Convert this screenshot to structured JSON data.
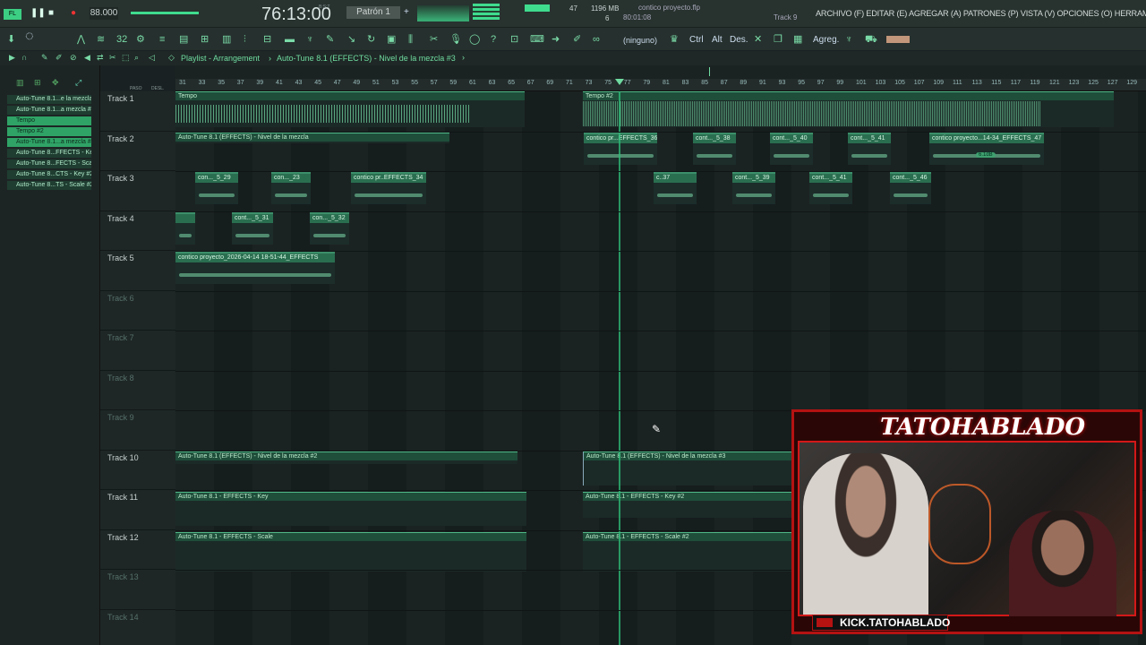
{
  "top": {
    "tempo": "88.000",
    "time": "76:13:00",
    "time_sub": "B:S:T",
    "pattern": "Patrón 1",
    "cpu": "47",
    "mem": "1196 MB",
    "voices": "6",
    "hint_file": "contico proyecto.flp",
    "hint_time": "80:01:08",
    "hint_track": "Track 9",
    "menu": "ARCHIVO (F) EDITAR (E) AGREGAR (A) PATRONES (P) VISTA (V) OPCIONES (O) HERRAMIENTAS (T) AYUDA"
  },
  "toolbar": {
    "ninguno": "(ninguno)",
    "ctrl": "Ctrl",
    "alt": "Alt",
    "des": "Des.",
    "agreg": "Agreg."
  },
  "playlist": {
    "title": "Playlist - Arrangement",
    "subtitle": "Auto-Tune 8.1 (EFFECTS) - Nivel de la mezcla #3",
    "paso": "PASO",
    "desl": "DESL."
  },
  "left_panel": {
    "items": [
      "Auto-Tune 8.1...e la mezcla",
      "Auto-Tune 8.1...a mezcla #2",
      "Tempo",
      "Tempo #2",
      "Auto-Tune 8.1...a mezcla #3",
      "Auto-Tune 8...FFECTS - Key",
      "Auto-Tune 8...FECTS - Scale",
      "Auto-Tune 8...CTS - Key #2",
      "Auto-Tune 8...TS - Scale #2"
    ]
  },
  "ruler": [
    "31",
    "33",
    "35",
    "37",
    "39",
    "41",
    "43",
    "45",
    "47",
    "49",
    "51",
    "53",
    "55",
    "57",
    "59",
    "61",
    "63",
    "65",
    "67",
    "69",
    "71",
    "73",
    "75",
    "77",
    "79",
    "81",
    "83",
    "85",
    "87",
    "89",
    "91",
    "93",
    "95",
    "97",
    "99",
    "101",
    "103",
    "105",
    "107",
    "109",
    "111",
    "113",
    "115",
    "117",
    "119",
    "121",
    "123",
    "125",
    "127",
    "129"
  ],
  "tracks": [
    "Track 1",
    "Track 2",
    "Track 3",
    "Track 4",
    "Track 5",
    "Track 6",
    "Track 7",
    "Track 8",
    "Track 9",
    "Track 10",
    "Track 11",
    "Track 12",
    "Track 13",
    "Track 14"
  ],
  "clips": {
    "t1a": "Tempo",
    "t1b": "Tempo #2",
    "t2a": "Auto-Tune 8.1 (EFFECTS) - Nivel de la mezcla",
    "t2b": "contico pr...EFFECTS_36",
    "t2c": "cont..._5_38",
    "t2d": "cont..._5_40",
    "t2e": "cont..._5_41",
    "t2f": "contico proyecto...14-34_EFFECTS_47",
    "t2g": "6.1dB",
    "t3a": "con..._5_29",
    "t3b": "con..._23",
    "t3c": "contico pr..EFFECTS_34",
    "t3d": "c..37",
    "t3e": "cont..._5_39",
    "t3f": "cont..._5_41",
    "t3g": "cont..._5_46",
    "t4b": "cont..._5_31",
    "t4c": "con..._5_32",
    "t5a": "contico proyecto_2026-04-14 18-51-44_EFFECTS",
    "t10a": "Auto-Tune 8.1 (EFFECTS) - Nivel de la mezcla #2",
    "t10b": "Auto-Tune 8.1 (EFFECTS) - Nivel de la mezcla #3",
    "t11a": "Auto-Tune 8.1 - EFFECTS - Key",
    "t11b": "Auto-Tune 8.1 - EFFECTS - Key #2",
    "t12a": "Auto-Tune 8.1 - EFFECTS - Scale",
    "t12b": "Auto-Tune 8.1 - EFFECTS - Scale #2"
  },
  "webcam": {
    "title": "TATOHABLADO",
    "handle": "KICK.TATOHABLADO",
    "accent": "#b51212"
  },
  "colors": {
    "accent": "#2fa366",
    "clip": "#3b8f69",
    "playhead": "#2fbf7a"
  }
}
